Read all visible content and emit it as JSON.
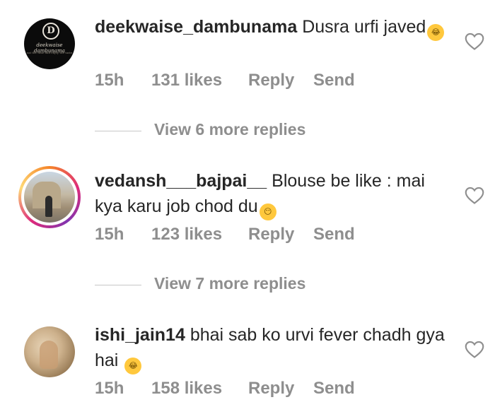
{
  "comments": [
    {
      "username": "deekwaise_dambunama",
      "text": "Dusra urfi javed",
      "emoji": "face-with-tears-of-joy",
      "time": "15h",
      "likes": "131 likes",
      "reply": "Reply",
      "send": "Send",
      "avatar": {
        "initial": "D",
        "brand": "deekwaise dambunama",
        "tagline": "eat the time and enjoy the taste"
      },
      "view_more": "View 6 more replies"
    },
    {
      "username": "vedansh___bajpai__",
      "text": "Blouse be like : mai kya karu job chod du",
      "emoji": "flushed-face",
      "time": "15h",
      "likes": "123 likes",
      "reply": "Reply",
      "send": "Send",
      "view_more": "View 7 more replies"
    },
    {
      "username": "ishi_jain14",
      "text": "bhai sab ko urvi fever chadh gya hai",
      "emoji": "face-with-tears-of-joy",
      "time": "15h",
      "likes": "158 likes",
      "reply": "Reply",
      "send": "Send"
    }
  ],
  "colors": {
    "text": "#262626",
    "meta": "#8e8e8e",
    "divider": "#c7c7c7",
    "emoji": "#ffc83d"
  },
  "icons": {
    "like": "heart-outline-icon"
  }
}
